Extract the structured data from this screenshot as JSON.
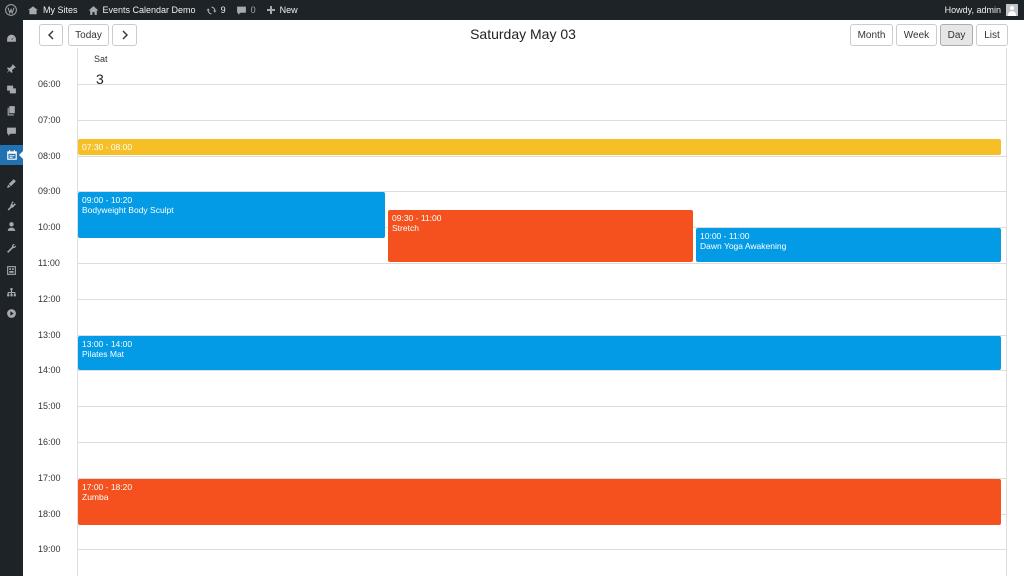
{
  "admin_bar": {
    "my_sites": "My Sites",
    "site_name": "Events Calendar Demo",
    "updates_count": "9",
    "comments_count": "0",
    "new_label": "New",
    "howdy": "Howdy, admin"
  },
  "sidebar": {
    "icons": [
      "dashboard-icon",
      "pin-icon",
      "media-icon",
      "pages-icon",
      "comments-icon",
      "calendar-icon",
      "appearance-icon",
      "plugins-icon",
      "users-icon",
      "tools-icon",
      "settings-icon",
      "network-icon",
      "play-icon"
    ],
    "active": "calendar-icon"
  },
  "toolbar": {
    "today_label": "Today",
    "title": "Saturday May 03",
    "views": [
      "Month",
      "Week",
      "Day",
      "List"
    ],
    "active_view": "Day"
  },
  "day_header": {
    "name": "Sat",
    "number": "3"
  },
  "hours": [
    "06:00",
    "07:00",
    "08:00",
    "09:00",
    "10:00",
    "11:00",
    "12:00",
    "13:00",
    "14:00",
    "15:00",
    "16:00",
    "17:00",
    "18:00",
    "19:00"
  ],
  "events": [
    {
      "time": "07:30 - 08:00",
      "name": "",
      "color": "#f6bf26"
    },
    {
      "time": "09:00 - 10:20",
      "name": "Bodyweight Body Sculpt",
      "color": "#039be5"
    },
    {
      "time": "09:30 - 11:00",
      "name": "Stretch",
      "color": "#f4511e"
    },
    {
      "time": "10:00 - 11:00",
      "name": "Dawn Yoga Awakening",
      "color": "#039be5"
    },
    {
      "time": "13:00 - 14:00",
      "name": "Pilates Mat",
      "color": "#039be5"
    },
    {
      "time": "17:00 - 18:20",
      "name": "Zumba",
      "color": "#f4511e"
    }
  ]
}
